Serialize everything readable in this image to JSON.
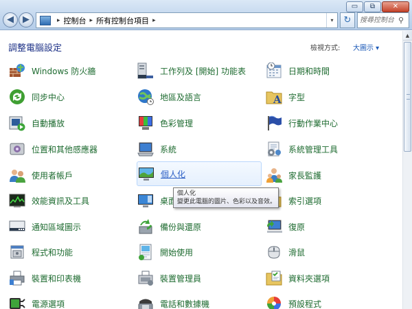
{
  "window": {
    "buttons": {
      "minimize": "▭",
      "maximize": "⧉",
      "close": "✕"
    }
  },
  "nav": {
    "back": "◀",
    "forward": "▶",
    "dropdown": "▾"
  },
  "address": {
    "crumbs": [
      "控制台",
      "所有控制台項目"
    ],
    "sep": "▸",
    "dropdown": "▾",
    "refresh": "↻"
  },
  "search": {
    "placeholder": "搜尋控制台",
    "icon": "search-icon"
  },
  "header": {
    "title": "調整電腦設定",
    "view_label": "檢視方式:",
    "view_value": "大圖示 ▾"
  },
  "items": [
    {
      "label": "Windows 防火牆",
      "icon": "firewall-icon"
    },
    {
      "label": "工作列及 [開始] 功能表",
      "icon": "taskbar-icon"
    },
    {
      "label": "日期和時間",
      "icon": "datetime-icon"
    },
    {
      "label": "同步中心",
      "icon": "sync-icon"
    },
    {
      "label": "地區及語言",
      "icon": "region-language-icon"
    },
    {
      "label": "字型",
      "icon": "fonts-icon"
    },
    {
      "label": "自動播放",
      "icon": "autoplay-icon"
    },
    {
      "label": "色彩管理",
      "icon": "color-management-icon"
    },
    {
      "label": "行動作業中心",
      "icon": "action-center-icon"
    },
    {
      "label": "位置和其他感應器",
      "icon": "location-sensor-icon"
    },
    {
      "label": "系統",
      "icon": "system-icon"
    },
    {
      "label": "系統管理工具",
      "icon": "admin-tools-icon"
    },
    {
      "label": "使用者帳戶",
      "icon": "user-accounts-icon"
    },
    {
      "label": "個人化",
      "icon": "personalization-icon"
    },
    {
      "label": "家長監護",
      "icon": "parental-controls-icon"
    },
    {
      "label": "效能資訊及工具",
      "icon": "performance-icon"
    },
    {
      "label": "桌面",
      "icon": "desktop-gadgets-icon"
    },
    {
      "label": "索引選項",
      "icon": "indexing-icon"
    },
    {
      "label": "通知區域圖示",
      "icon": "notification-area-icon"
    },
    {
      "label": "備份與還原",
      "icon": "backup-restore-icon"
    },
    {
      "label": "復原",
      "icon": "recovery-icon"
    },
    {
      "label": "程式和功能",
      "icon": "programs-features-icon"
    },
    {
      "label": "開始使用",
      "icon": "getting-started-icon"
    },
    {
      "label": "滑鼠",
      "icon": "mouse-icon"
    },
    {
      "label": "裝置和印表機",
      "icon": "devices-printers-icon"
    },
    {
      "label": "裝置管理員",
      "icon": "device-manager-icon"
    },
    {
      "label": "資料夾選項",
      "icon": "folder-options-icon"
    },
    {
      "label": "電源選項",
      "icon": "power-options-icon"
    },
    {
      "label": "電話和數據機",
      "icon": "phone-modem-icon"
    },
    {
      "label": "預設程式",
      "icon": "default-programs-icon"
    }
  ],
  "tooltip": {
    "title": "個人化",
    "description": "變更此電腦的圖片、色彩以及音效。"
  },
  "scrollbar": {
    "up_arrow": "▲"
  }
}
